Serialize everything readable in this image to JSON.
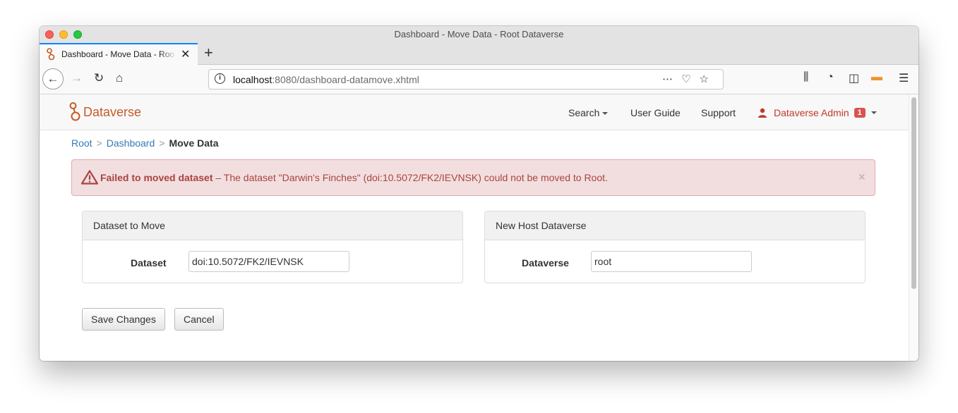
{
  "window": {
    "title": "Dashboard - Move Data - Root Dataverse"
  },
  "tab": {
    "title": "Dashboard - Move Data - Root Dataverse"
  },
  "urlbar": {
    "host": "localhost",
    "path": ":8080/dashboard-datamove.xhtml"
  },
  "site": {
    "brand": "Dataverse",
    "nav": {
      "search": "Search",
      "user_guide": "User Guide",
      "support": "Support",
      "user": "Dataverse Admin",
      "notifications": "1"
    }
  },
  "breadcrumb": {
    "root": "Root",
    "dashboard": "Dashboard",
    "current": "Move Data",
    "separator": ">"
  },
  "alert": {
    "title": "Failed to moved dataset",
    "message": " – The dataset \"Darwin's Finches\" (doi:10.5072/FK2/IEVNSK) could not be moved to Root.",
    "close": "×"
  },
  "panels": {
    "dataset": {
      "heading": "Dataset to Move",
      "label": "Dataset",
      "value": "doi:10.5072/FK2/IEVNSK"
    },
    "host": {
      "heading": "New Host Dataverse",
      "label": "Dataverse",
      "value": "root"
    }
  },
  "buttons": {
    "save": "Save Changes",
    "cancel": "Cancel"
  },
  "colors": {
    "brand": "#c55b28",
    "link": "#337ab7",
    "alert_bg": "#f2dede",
    "alert_text": "#a94442",
    "tab_accent": "#0a84ff"
  }
}
